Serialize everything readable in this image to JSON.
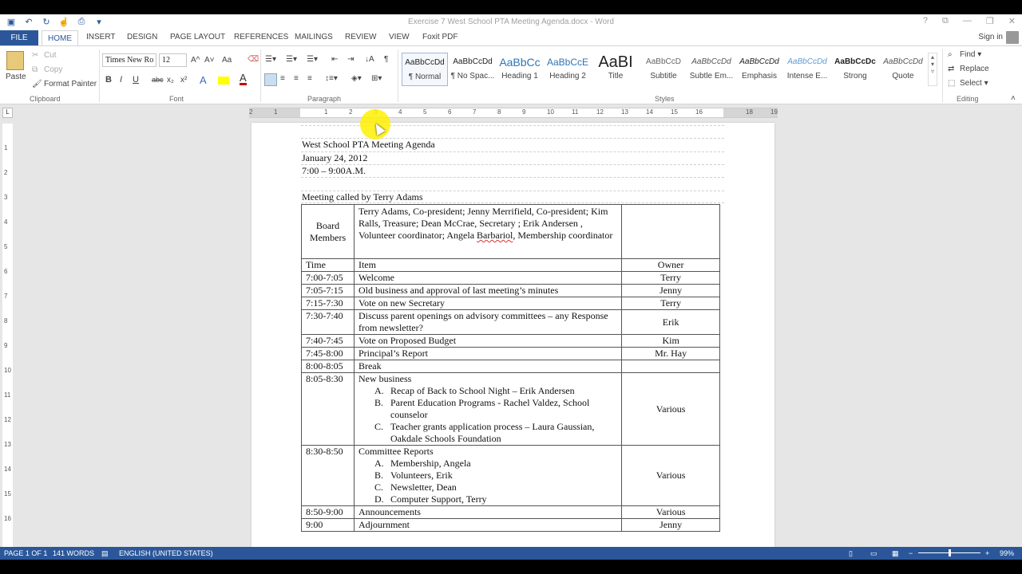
{
  "window": {
    "title": "Exercise 7 West School PTA Meeting Agenda.docx - Word",
    "controls": [
      "?",
      "⧉",
      "—",
      "❐",
      "✕"
    ]
  },
  "qat": {
    "save_icon": "save-icon",
    "undo_icon": "undo-icon",
    "redo_icon": "redo-icon",
    "touch_icon": "touch-mode-icon",
    "customize_icon": "customize-icon"
  },
  "tabs": {
    "file": "FILE",
    "home": "HOME",
    "items": [
      "INSERT",
      "DESIGN",
      "PAGE LAYOUT",
      "REFERENCES",
      "MAILINGS",
      "REVIEW",
      "VIEW",
      "Foxit PDF"
    ],
    "signin": "Sign in"
  },
  "clipboard": {
    "paste": "Paste",
    "cut": "Cut",
    "copy": "Copy",
    "format_painter": "Format Painter",
    "label": "Clipboard"
  },
  "font": {
    "name": "Times New Ro",
    "size": "12",
    "label": "Font",
    "bold": "B",
    "italic": "I",
    "underline": "U",
    "strike": "abc",
    "sub": "x₂",
    "sup": "x²",
    "grow": "A^",
    "shrink": "A˅",
    "case": "Aa"
  },
  "paragraph": {
    "label": "Paragraph"
  },
  "styles": {
    "label": "Styles",
    "items": [
      {
        "preview": "AaBbCcDd",
        "name": "¶ Normal"
      },
      {
        "preview": "AaBbCcDd",
        "name": "¶ No Spac..."
      },
      {
        "preview": "AaBbCc",
        "name": "Heading 1"
      },
      {
        "preview": "AaBbCcE",
        "name": "Heading 2"
      },
      {
        "preview": "AaBI",
        "name": "Title"
      },
      {
        "preview": "AaBbCcD",
        "name": "Subtitle"
      },
      {
        "preview": "AaBbCcDd",
        "name": "Subtle Em..."
      },
      {
        "preview": "AaBbCcDd",
        "name": "Emphasis"
      },
      {
        "preview": "AaBbCcDd",
        "name": "Intense E..."
      },
      {
        "preview": "AaBbCcDc",
        "name": "Strong"
      },
      {
        "preview": "AaBbCcDd",
        "name": "Quote"
      }
    ]
  },
  "editing": {
    "find": "Find",
    "replace": "Replace",
    "select": "Select",
    "label": "Editing"
  },
  "ruler": {
    "h_ticks": [
      "2",
      "1",
      "1",
      "2",
      "3",
      "4",
      "5",
      "6",
      "7",
      "8",
      "9",
      "10",
      "11",
      "12",
      "13",
      "14",
      "15",
      "16",
      "18",
      "19"
    ],
    "v_ticks": [
      "1",
      "2",
      "3",
      "4",
      "5",
      "6",
      "7",
      "8",
      "9",
      "10",
      "11",
      "12",
      "13",
      "14",
      "15",
      "16"
    ]
  },
  "document": {
    "title": "West School PTA Meeting Agenda",
    "date": "January 24, 2012",
    "time": "7:00 – 9:00A.M.",
    "called_by": "Meeting called by Terry Adams",
    "board": {
      "label": "Board Members",
      "text_pre": "Terry Adams, Co-president; Jenny Merrifield, Co-president; Kim Ralls, Treasure; Dean McCrae, Secretary ; Erik Andersen , Volunteer coordinator; Angela  ",
      "squiggle": "Barbariol",
      "text_post": ", Membership coordinator"
    },
    "headers": [
      "Time",
      "Item",
      "Owner"
    ],
    "rows": [
      {
        "time": "7:00-7:05",
        "item": "Welcome",
        "owner": "Terry"
      },
      {
        "time": "7:05-7:15",
        "item": "Old business and approval of last meeting’s minutes",
        "owner": "Jenny"
      },
      {
        "time": "7:15-7:30",
        "item": "Vote on new Secretary",
        "owner": "Terry"
      },
      {
        "time": "7:30-7:40",
        "item": "Discuss parent openings on advisory committees – any Response from newsletter?",
        "owner": "Erik"
      },
      {
        "time": "7:40-7:45",
        "item": "Vote on Proposed Budget",
        "owner": "Kim"
      },
      {
        "time": "7:45-8:00",
        "item": "Principal’s Report",
        "owner": "Mr. Hay"
      },
      {
        "time": "8:00-8:05",
        "item": "Break",
        "owner": ""
      }
    ],
    "new_business": {
      "time": "8:05-8:30",
      "item": "New business",
      "owner": "Various",
      "subs": [
        {
          "l": "A.",
          "t": "Recap of Back to School Night – Erik  Andersen"
        },
        {
          "l": "B.",
          "t": "Parent Education Programs  - Rachel Valdez, School counselor"
        },
        {
          "l": "C.",
          "t": "Teacher grants application process – Laura Gaussian, Oakdale Schools Foundation"
        }
      ]
    },
    "committee": {
      "time": "8:30-8:50",
      "item": "Committee Reports",
      "owner": "Various",
      "subs": [
        {
          "l": "A.",
          "t": "Membership,  Angela"
        },
        {
          "l": "B.",
          "t": "Volunteers, Erik"
        },
        {
          "l": "C.",
          "t": "Newsletter, Dean"
        },
        {
          "l": "D.",
          "t": "Computer Support, Terry"
        }
      ]
    },
    "tail_rows": [
      {
        "time": "8:50-9:00",
        "item": "Announcements",
        "owner": "Various"
      },
      {
        "time": "9:00",
        "item": "Adjournment",
        "owner": "Jenny"
      }
    ]
  },
  "status": {
    "page": "PAGE 1 OF 1",
    "words": "141 WORDS",
    "language": "ENGLISH (UNITED STATES)",
    "zoom": "99%"
  },
  "colors": {
    "accent": "#2b579a",
    "cursor_highlight": "#fff000"
  }
}
